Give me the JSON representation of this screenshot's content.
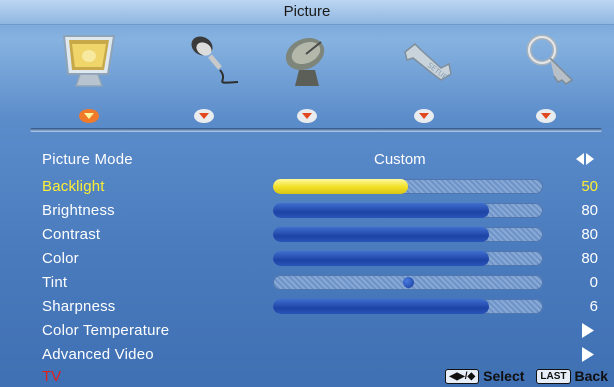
{
  "header": {
    "title": "Picture"
  },
  "categories": [
    {
      "name": "picture",
      "icon": "monitor-icon"
    },
    {
      "name": "audio",
      "icon": "microphone-icon"
    },
    {
      "name": "tv",
      "icon": "satellite-dish-icon"
    },
    {
      "name": "setup",
      "icon": "wrench-icon"
    },
    {
      "name": "lock",
      "icon": "key-icon"
    }
  ],
  "menu": {
    "picture_mode": {
      "label": "Picture Mode",
      "value": "Custom"
    },
    "backlight": {
      "label": "Backlight",
      "value": "50",
      "level": 0.5
    },
    "brightness": {
      "label": "Brightness",
      "value": "80",
      "level": 0.8
    },
    "contrast": {
      "label": "Contrast",
      "value": "80",
      "level": 0.8
    },
    "color": {
      "label": "Color",
      "value": "80",
      "level": 0.8
    },
    "tint": {
      "label": "Tint",
      "value": "0",
      "level": 0.5
    },
    "sharpness": {
      "label": "Sharpness",
      "value": "6",
      "level": 0.8
    },
    "color_temperature": {
      "label": "Color Temperature"
    },
    "advanced_video": {
      "label": "Advanced Video"
    }
  },
  "footer": {
    "source": "TV",
    "nav_key": "◀▶/◆",
    "select_label": "Select",
    "last_key": "LAST",
    "back_label": "Back"
  },
  "colors": {
    "highlight": "#ffee33",
    "bar_fill": "#1c44a6",
    "source_text": "#e0201a"
  }
}
